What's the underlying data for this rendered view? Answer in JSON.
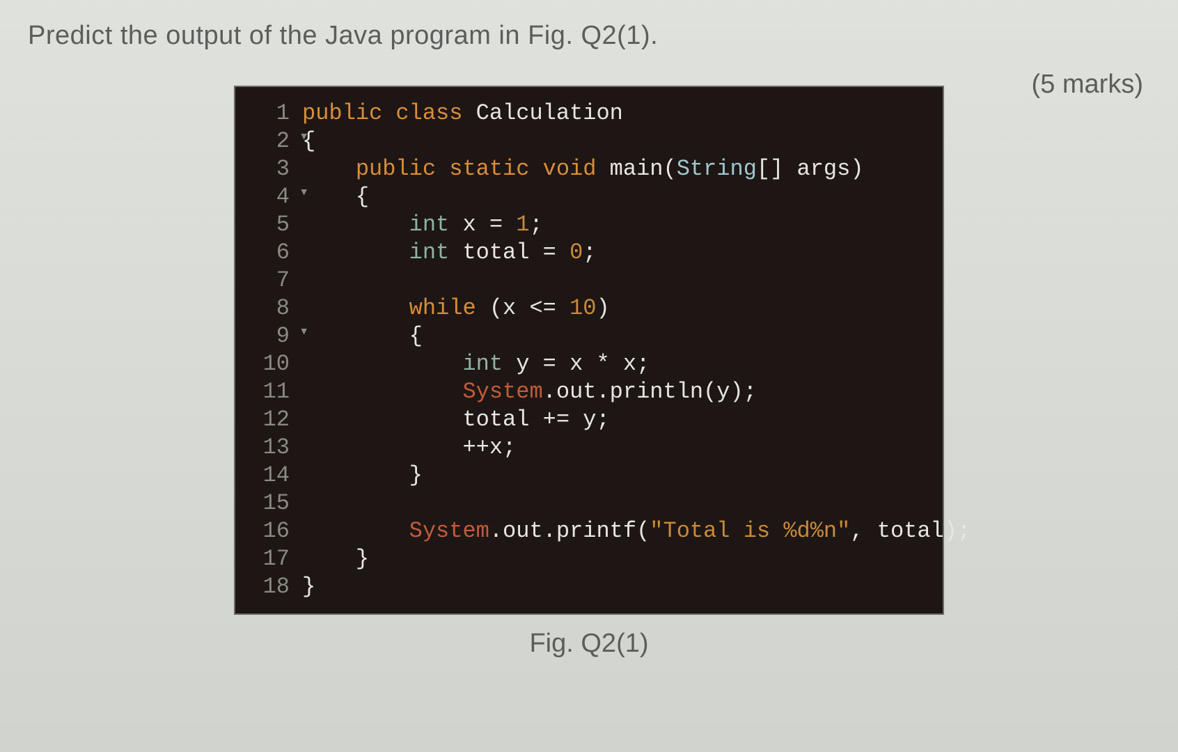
{
  "question": "Predict the output of the Java program in Fig. Q2(1).",
  "marks": "(5 marks)",
  "caption": "Fig. Q2(1)",
  "code": {
    "lines": [
      {
        "n": "1",
        "indent": 0,
        "fold": false,
        "tokens": [
          [
            "kw",
            "public "
          ],
          [
            "kw",
            "class "
          ],
          [
            "id",
            "Calculation"
          ]
        ]
      },
      {
        "n": "2",
        "indent": 0,
        "fold": true,
        "tokens": [
          [
            "brace",
            "{"
          ]
        ]
      },
      {
        "n": "3",
        "indent": 1,
        "fold": false,
        "tokens": [
          [
            "kw",
            "public "
          ],
          [
            "kw",
            "static "
          ],
          [
            "kw",
            "void "
          ],
          [
            "id",
            "main"
          ],
          [
            "id",
            "("
          ],
          [
            "cls",
            "String"
          ],
          [
            "id",
            "[] args)"
          ]
        ]
      },
      {
        "n": "4",
        "indent": 1,
        "fold": true,
        "tokens": [
          [
            "brace",
            "{"
          ]
        ]
      },
      {
        "n": "5",
        "indent": 2,
        "fold": false,
        "tokens": [
          [
            "type",
            "int"
          ],
          [
            "id",
            " x = "
          ],
          [
            "num",
            "1"
          ],
          [
            "id",
            ";"
          ]
        ]
      },
      {
        "n": "6",
        "indent": 2,
        "fold": false,
        "tokens": [
          [
            "type",
            "int"
          ],
          [
            "id",
            " total = "
          ],
          [
            "num",
            "0"
          ],
          [
            "id",
            ";"
          ]
        ]
      },
      {
        "n": "7",
        "indent": 0,
        "fold": false,
        "tokens": []
      },
      {
        "n": "8",
        "indent": 2,
        "fold": false,
        "tokens": [
          [
            "kw",
            "while"
          ],
          [
            "id",
            " (x <= "
          ],
          [
            "num",
            "10"
          ],
          [
            "id",
            ")"
          ]
        ]
      },
      {
        "n": "9",
        "indent": 2,
        "fold": true,
        "tokens": [
          [
            "brace",
            "{"
          ]
        ]
      },
      {
        "n": "10",
        "indent": 3,
        "fold": false,
        "tokens": [
          [
            "type",
            "int"
          ],
          [
            "id",
            " y = x * x;"
          ]
        ]
      },
      {
        "n": "11",
        "indent": 3,
        "fold": false,
        "tokens": [
          [
            "sys",
            "System"
          ],
          [
            "id",
            ".out.println(y);"
          ]
        ]
      },
      {
        "n": "12",
        "indent": 3,
        "fold": false,
        "tokens": [
          [
            "id",
            "total += y;"
          ]
        ]
      },
      {
        "n": "13",
        "indent": 3,
        "fold": false,
        "tokens": [
          [
            "id",
            "++x;"
          ]
        ]
      },
      {
        "n": "14",
        "indent": 2,
        "fold": false,
        "tokens": [
          [
            "brace",
            "}"
          ]
        ]
      },
      {
        "n": "15",
        "indent": 0,
        "fold": false,
        "tokens": []
      },
      {
        "n": "16",
        "indent": 2,
        "fold": false,
        "tokens": [
          [
            "sys",
            "System"
          ],
          [
            "id",
            ".out.printf("
          ],
          [
            "str",
            "\"Total is %d%n\""
          ],
          [
            "id",
            ", total);"
          ]
        ]
      },
      {
        "n": "17",
        "indent": 1,
        "fold": false,
        "tokens": [
          [
            "brace",
            "}"
          ]
        ]
      },
      {
        "n": "18",
        "indent": 0,
        "fold": false,
        "tokens": [
          [
            "brace",
            "}"
          ]
        ]
      }
    ]
  }
}
